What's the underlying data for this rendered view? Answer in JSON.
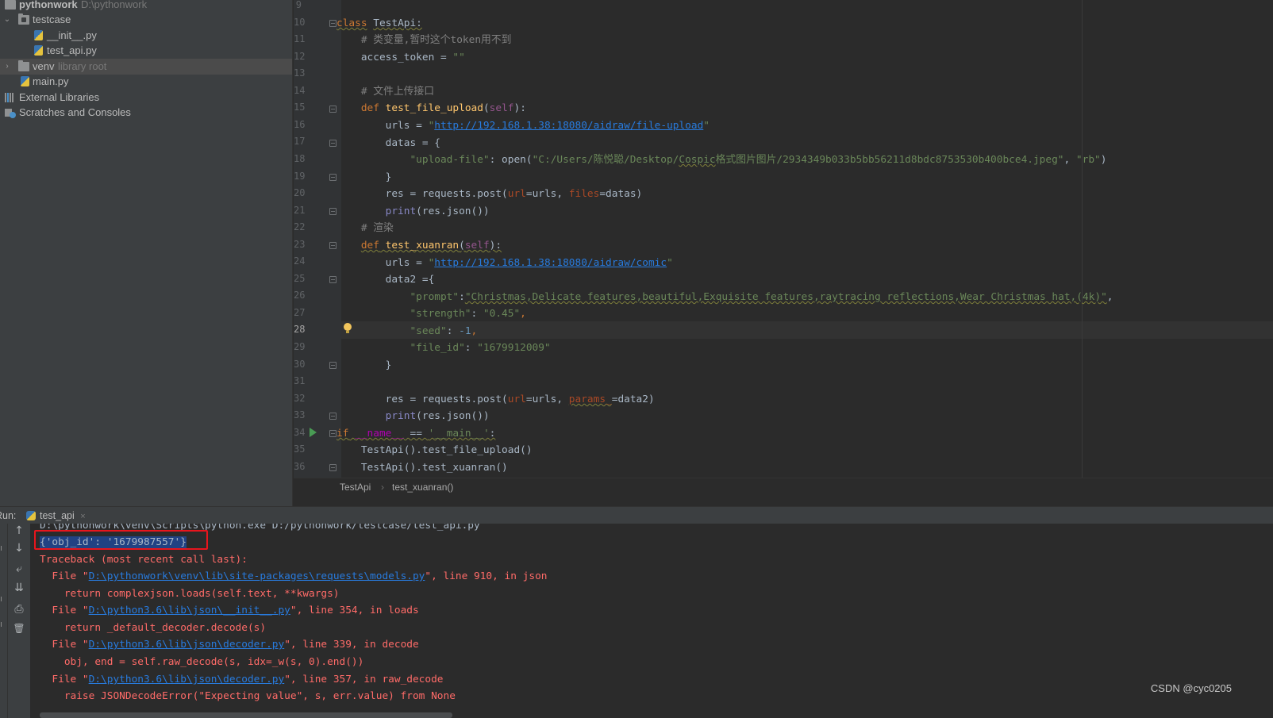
{
  "project": {
    "root_name": "pythonwork",
    "root_path": "D:\\pythonwork",
    "items": [
      {
        "label": "testcase",
        "suffix": ""
      },
      {
        "label": "__init__.py",
        "suffix": ""
      },
      {
        "label": "test_api.py",
        "suffix": ""
      },
      {
        "label": "venv",
        "suffix": "library root"
      },
      {
        "label": "main.py",
        "suffix": ""
      },
      {
        "label": "External Libraries",
        "suffix": ""
      },
      {
        "label": "Scratches and Consoles",
        "suffix": ""
      }
    ]
  },
  "editor": {
    "line_numbers": [
      "9",
      "10",
      "11",
      "12",
      "13",
      "14",
      "15",
      "16",
      "17",
      "18",
      "19",
      "20",
      "21",
      "22",
      "23",
      "24",
      "25",
      "26",
      "27",
      "28",
      "29",
      "30",
      "31",
      "32",
      "33",
      "34",
      "35",
      "36"
    ],
    "current_line": "28",
    "code": {
      "l10_kw": "class",
      "l10_name": "TestApi:",
      "l11": "# 类变量,暂时这个token用不到",
      "l12_a": "access_token = ",
      "l12_b": "\"\"",
      "l14": "# 文件上传接口",
      "l15_kw": "def",
      "l15_fn": "test_file_upload",
      "l15_p1": "(",
      "l15_self": "self",
      "l15_p2": "):",
      "l16_a": "urls = ",
      "l16_q1": "\"",
      "l16_url": "http://192.168.1.38:18080/aidraw/file-upload",
      "l16_q2": "\"",
      "l17": "datas = {",
      "l18_key": "\"upload-file\"",
      "l18_colon": ": ",
      "l18_open": "open",
      "l18_p": "(",
      "l18_path1": "\"C:/Users/陈悦聪/Desktop/",
      "l18_path2": "Cospic",
      "l18_path3": "格式图片图片/2934349b033b5bb56211d8bdc8753530b400bce4.jpeg\"",
      "l18_comma": ", ",
      "l18_rb": "\"rb\"",
      "l18_close": ")",
      "l19": "}",
      "l20_a": "res = requests.post(",
      "l20_url": "url",
      "l20_b": "=urls, ",
      "l20_files": "files",
      "l20_c": "=datas)",
      "l21_print": "print",
      "l21_rest": "(res.json())",
      "l22": "# 渲染",
      "l23_kw": "def",
      "l23_fn": "test_xuanran",
      "l23_p1": "(",
      "l23_self": "self",
      "l23_p2": "):",
      "l24_a": "urls = ",
      "l24_q1": "\"",
      "l24_url": "http://192.168.1.38:18080/aidraw/comic",
      "l24_q2": "\"",
      "l25": "data2 ={",
      "l26_key": "\"prompt\"",
      "l26_colon": ":",
      "l26_val": "\"Christmas,Delicate features,beautiful,Exquisite features,raytracing reflections,Wear Christmas hat,(4k)\"",
      "l26_comma": ",",
      "l27_key": "\"strength\"",
      "l27_colon": ": ",
      "l27_val": "\"0.45\"",
      "l27_comma": ",",
      "l28_key": "\"seed\"",
      "l28_colon": ": ",
      "l28_val": "-1",
      "l28_comma": ",",
      "l29_key": "\"file_id\"",
      "l29_colon": ": ",
      "l29_val": "\"1679912009\"",
      "l30": "}",
      "l32_a": "res = requests.post(",
      "l32_url": "url",
      "l32_b": "=urls, ",
      "l32_params": "params_",
      "l32_c": "=data2)",
      "l33_print": "print",
      "l33_rest": "(res.json())",
      "l34_kw": "if",
      "l34_sp": " ",
      "l34_name": "__name__",
      "l34_eq": " == ",
      "l34_str": "'__main__'",
      "l34_colon": ":",
      "l35": "TestApi().test_file_upload()",
      "l36": "TestApi().test_xuanran()"
    }
  },
  "breadcrumb": {
    "class_name": "TestApi",
    "separator": "›",
    "method_name": "test_xuanran()"
  },
  "run": {
    "label": "Run:",
    "tab_label": "test_api",
    "close_icon": "×",
    "console": {
      "cmd": "D:\\pythonwork\\venv\\Scripts\\python.exe D:/pythonwork/testcase/test_api.py",
      "result": "{'obj_id': '1679987557'}",
      "tb_head": "Traceback (most recent call last):",
      "f1_pre": "  File \"",
      "f1_link": "D:\\pythonwork\\venv\\lib\\site-packages\\requests\\models.py",
      "f1_post": "\", line 910, in json",
      "f1_code": "    return complexjson.loads(self.text, **kwargs)",
      "f2_pre": "  File \"",
      "f2_link": "D:\\python3.6\\lib\\json\\__init__.py",
      "f2_post": "\", line 354, in loads",
      "f2_code": "    return _default_decoder.decode(s)",
      "f3_pre": "  File \"",
      "f3_link": "D:\\python3.6\\lib\\json\\decoder.py",
      "f3_post": "\", line 339, in decode",
      "f3_code": "    obj, end = self.raw_decode(s, idx=_w(s, 0).end())",
      "f4_pre": "  File \"",
      "f4_link": "D:\\python3.6\\lib\\json\\decoder.py",
      "f4_post": "\", line 357, in raw_decode",
      "f4_code": "    raise JSONDecodeError(\"Expecting value\", s, err.value) from None"
    }
  },
  "watermark": "CSDN @cyc0205",
  "icons": {
    "run_gutter": "run-triangle-icon",
    "bulb": "intention-bulb-icon",
    "up": "↑",
    "down": "↓",
    "wrap": "⤶",
    "scroll_end": "⇊",
    "print": "⎙",
    "trash": "🗑"
  },
  "colors": {
    "background": "#2b2b2b",
    "panel": "#3c3f41",
    "keyword": "#cc7832",
    "string": "#6a8759",
    "error": "#ff6b68",
    "link": "#287bde",
    "highlight_box": "#e8151d"
  }
}
